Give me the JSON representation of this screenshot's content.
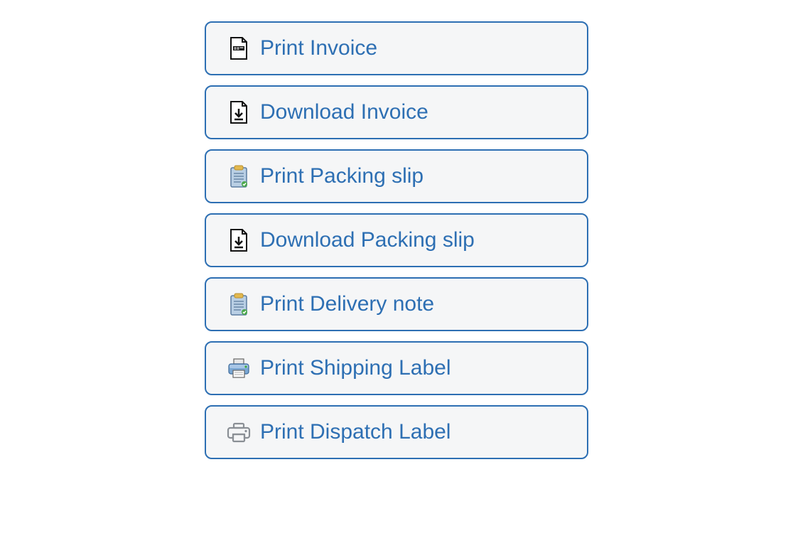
{
  "actions": [
    {
      "id": "print-invoice",
      "label": "Print Invoice",
      "icon": "invoice-file-icon"
    },
    {
      "id": "download-invoice",
      "label": "Download Invoice",
      "icon": "download-file-icon"
    },
    {
      "id": "print-packing-slip",
      "label": "Print Packing slip",
      "icon": "clipboard-icon"
    },
    {
      "id": "download-packing-slip",
      "label": "Download Packing slip",
      "icon": "download-file-icon"
    },
    {
      "id": "print-delivery-note",
      "label": "Print Delivery note",
      "icon": "clipboard-icon"
    },
    {
      "id": "print-shipping-label",
      "label": "Print Shipping Label",
      "icon": "printer-solid-icon"
    },
    {
      "id": "print-dispatch-label",
      "label": "Print Dispatch Label",
      "icon": "printer-outline-icon"
    }
  ],
  "colors": {
    "border": "#2d6fb3",
    "text": "#2d6fb3",
    "bg": "#f5f6f7"
  }
}
